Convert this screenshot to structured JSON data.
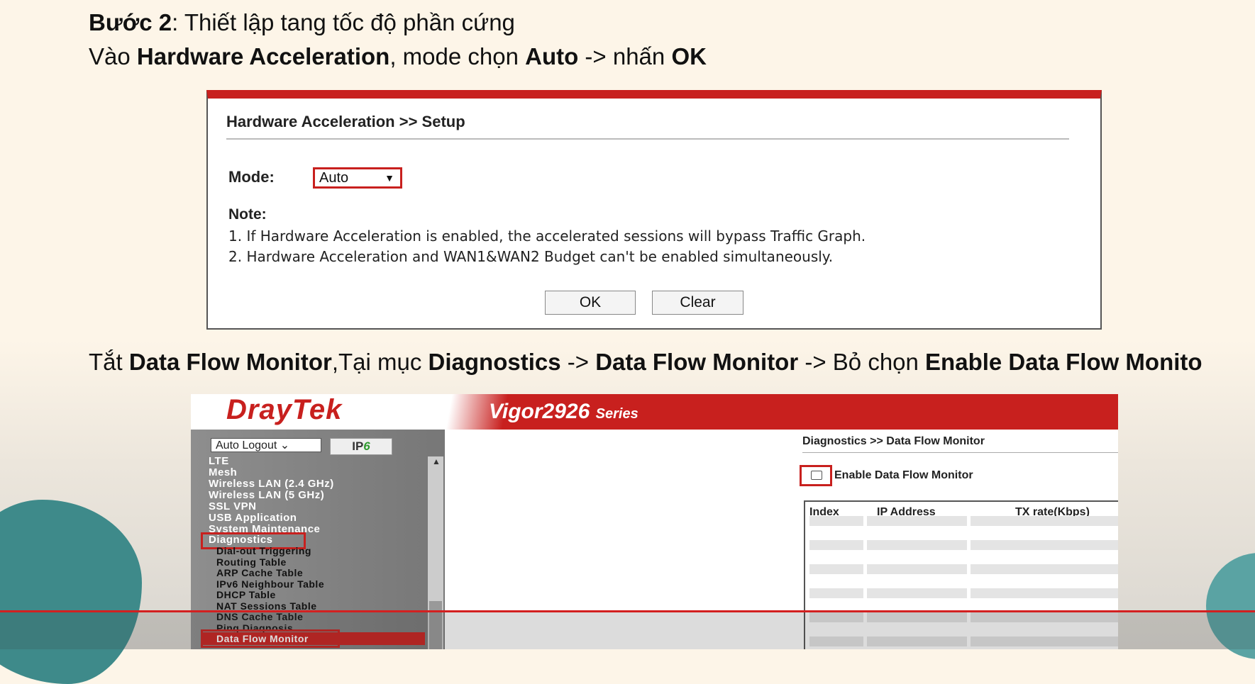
{
  "step": {
    "line1_bold": "Bước 2",
    "line1_rest": ": Thiết lập tang tốc độ phần cứng",
    "line2_a": "Vào ",
    "line2_b": "Hardware Acceleration",
    "line2_c": ", mode chọn ",
    "line2_d": "Auto",
    "line2_e": " -> nhấn ",
    "line2_f": "OK"
  },
  "hw_panel": {
    "title": "Hardware Acceleration >> Setup",
    "mode_label": "Mode:",
    "mode_value": "Auto",
    "note_label": "Note:",
    "notes": [
      "1. If Hardware Acceleration is enabled, the accelerated sessions will bypass Traffic Graph.",
      "2. Hardware Acceleration and WAN1&WAN2 Budget can't be enabled simultaneously."
    ],
    "ok_label": "OK",
    "clear_label": "Clear",
    "accent": "#c8201e"
  },
  "instruction2": {
    "a": "Tắt ",
    "b": "Data Flow Monitor",
    "c": ",Tại mục ",
    "d": "Diagnostics",
    "e": " -> ",
    "f": "Data Flow Monitor",
    "g": " -> Bỏ chọn ",
    "h": "Enable Data Flow Monito"
  },
  "draytek": {
    "logo": "DrayTek",
    "model": "Vigor2926",
    "model_suffix": "Series",
    "auto_logout": "Auto Logout",
    "ipv6_a": "IP",
    "ipv6_b": "6",
    "menu": [
      "LTE",
      "Mesh",
      "Wireless LAN (2.4 GHz)",
      "Wireless LAN (5 GHz)",
      "SSL VPN",
      "USB Application",
      "System Maintenance",
      "Diagnostics"
    ],
    "submenu": [
      "Dial-out Triggering",
      "Routing Table",
      "ARP Cache Table",
      "IPv6 Neighbour Table",
      "DHCP Table",
      "NAT Sessions Table",
      "DNS Cache Table",
      "Ping Diagnosis",
      "Data Flow Monitor"
    ],
    "breadcrumb": "Diagnostics >> Data Flow Monitor",
    "enable_label": "Enable Data Flow Monitor",
    "table_headers": [
      "Index",
      "IP Address",
      "TX rate(Kbps)"
    ]
  }
}
